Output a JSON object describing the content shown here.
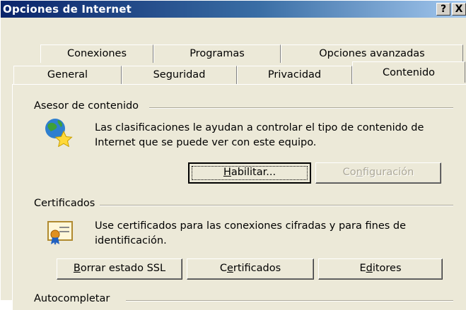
{
  "window": {
    "title": "Opciones de Internet",
    "help_label": "?",
    "close_label": "X"
  },
  "tabs_row1": [
    {
      "label": "Conexiones"
    },
    {
      "label": "Programas"
    },
    {
      "label": "Opciones avanzadas"
    }
  ],
  "tabs_row2": [
    {
      "label": "General"
    },
    {
      "label": "Seguridad"
    },
    {
      "label": "Privacidad"
    },
    {
      "label": "Contenido"
    }
  ],
  "active_tab": "Contenido",
  "content_advisor": {
    "group_label": "Asesor de contenido",
    "description_line1": "Las clasificaciones le ayudan a controlar el tipo de contenido de",
    "description_line2": "Internet que se puede ver con este equipo.",
    "enable_pre": "",
    "enable_key": "H",
    "enable_post": "abilitar...",
    "settings_pre": "Co",
    "settings_key": "n",
    "settings_post": "figuración",
    "icon": "globe-star-icon"
  },
  "certificates": {
    "group_label": "Certificados",
    "description_line1": "Use certificados para las conexiones cifradas y para fines de",
    "description_line2": "identificación.",
    "clear_ssl_pre": "",
    "clear_ssl_key": "B",
    "clear_ssl_post": "orrar estado SSL",
    "certs_pre": "C",
    "certs_key": "e",
    "certs_post": "rtificados",
    "publishers_pre": "E",
    "publishers_key": "d",
    "publishers_post": "itores",
    "icon": "certificate-icon"
  },
  "autocomplete": {
    "group_label": "Autocompletar"
  }
}
